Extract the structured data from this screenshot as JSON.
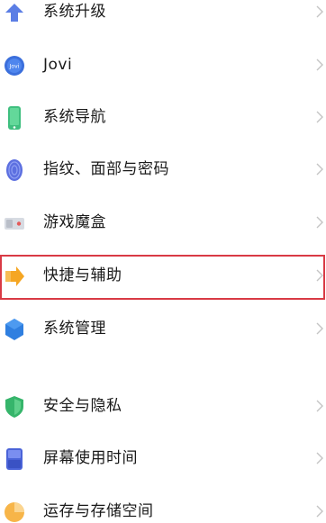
{
  "settings": {
    "items": [
      {
        "label": "系统升级",
        "icon": "upgrade-arrow-icon"
      },
      {
        "label": "Jovi",
        "icon": "jovi-icon"
      },
      {
        "label": "系统导航",
        "icon": "phone-navigation-icon"
      },
      {
        "label": "指纹、面部与密码",
        "icon": "fingerprint-icon"
      },
      {
        "label": "游戏魔盒",
        "icon": "game-box-icon"
      },
      {
        "label": "快捷与辅助",
        "icon": "shortcut-arrow-icon"
      },
      {
        "label": "系统管理",
        "icon": "system-management-icon"
      },
      {
        "label": "安全与隐私",
        "icon": "security-shield-icon"
      },
      {
        "label": "屏幕使用时间",
        "icon": "screen-time-icon"
      },
      {
        "label": "运存与存储空间",
        "icon": "storage-pie-icon"
      }
    ]
  },
  "colors": {
    "highlight_border": "#d93a45",
    "chevron": "#c4c4c4",
    "divider_gap_background": "#ffffff"
  }
}
